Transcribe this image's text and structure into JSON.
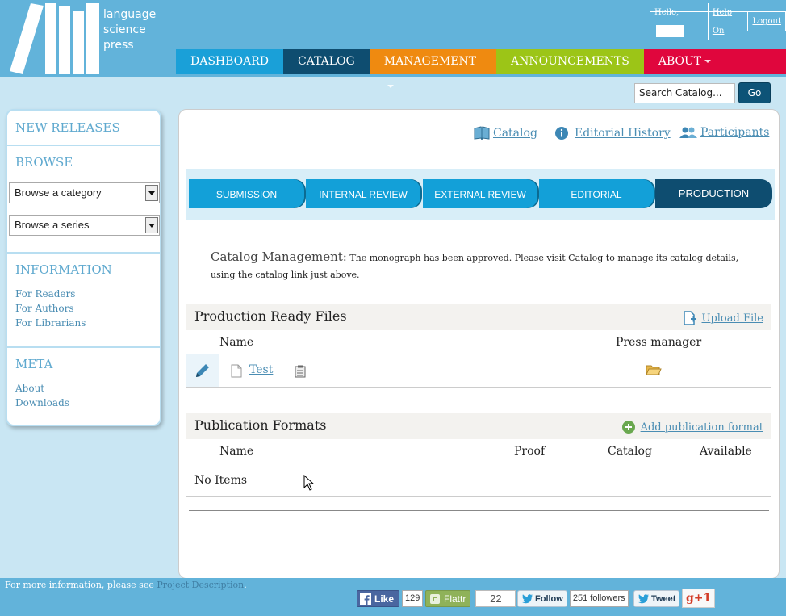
{
  "brand": {
    "line1": "language",
    "line2": "science",
    "line3": "press"
  },
  "user": {
    "hello": "Hello,",
    "help": "Help On",
    "logout": "Logout"
  },
  "nav": [
    {
      "label": "DASHBOARD",
      "color": "#1aa0d8"
    },
    {
      "label": "CATALOG",
      "color": "#0e4d70"
    },
    {
      "label": "MANAGEMENT",
      "color": "#ef8a10"
    },
    {
      "label": "ANNOUNCEMENTS",
      "color": "#9cc517"
    },
    {
      "label": "ABOUT",
      "color": "#e0063d"
    }
  ],
  "search": {
    "placeholder": "Search Catalog...",
    "go": "Go"
  },
  "sidebar": {
    "new_releases": "NEW RELEASES",
    "browse": "BROWSE",
    "browse_category": "Browse a category",
    "browse_series": "Browse a series",
    "information": "INFORMATION",
    "info_links": [
      "For Readers",
      "For Authors",
      "For Librarians"
    ],
    "meta": "META",
    "meta_links": [
      "About",
      "Downloads"
    ]
  },
  "toplinks": {
    "catalog": "Catalog",
    "editorial_history": "Editorial History",
    "participants": "Participants"
  },
  "stages": [
    "SUBMISSION",
    "INTERNAL REVIEW",
    "EXTERNAL REVIEW",
    "EDITORIAL",
    "PRODUCTION"
  ],
  "notice": {
    "label": "Catalog Management:",
    "text": "The monograph has been approved. Please visit Catalog to manage its catalog details, using the catalog link just above."
  },
  "production_files": {
    "title": "Production Ready Files",
    "action": "Upload File",
    "col_name": "Name",
    "col_manager": "Press manager",
    "rows": [
      {
        "name": "Test"
      }
    ]
  },
  "publication_formats": {
    "title": "Publication Formats",
    "action": "Add publication format",
    "cols": [
      "Name",
      "Proof",
      "Catalog",
      "Available"
    ],
    "empty": "No Items"
  },
  "footer": {
    "text": "For more information, please see",
    "link": "Project Description",
    "period": ".",
    "like": "Like",
    "like_count": "129",
    "flattr": "Flattr",
    "flattr_count": "22",
    "follow": "Follow",
    "followers": "251 followers",
    "tweet": "Tweet",
    "gplus": "g+1"
  }
}
